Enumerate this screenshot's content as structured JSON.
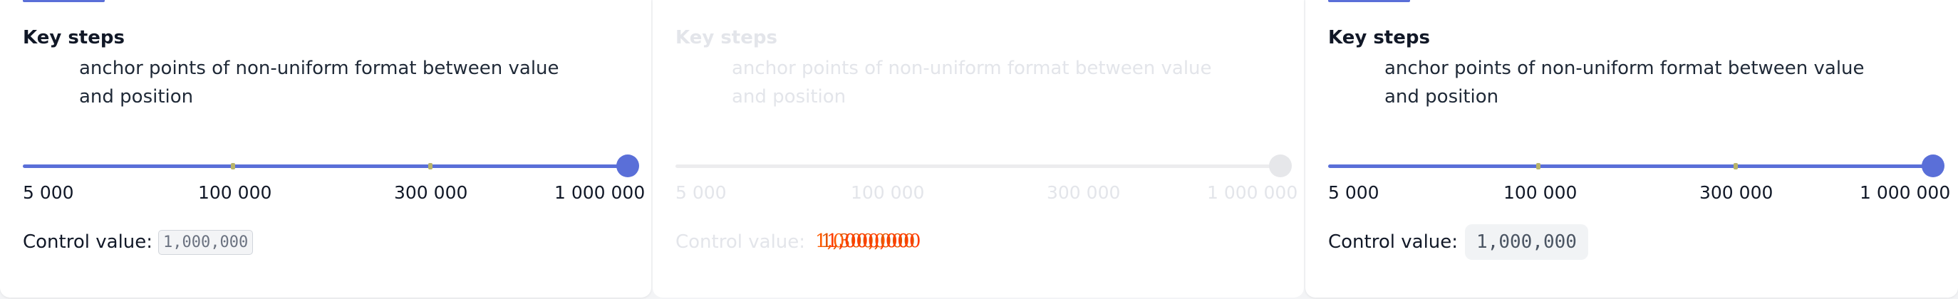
{
  "cards": [
    {
      "heading": "Key steps",
      "description": "anchor points of non-uniform format between value and position",
      "steps": [
        "5 000",
        "100 000",
        "300 000",
        "1 000 000"
      ],
      "control_label": "Control value:",
      "control_value": "1,000,000",
      "slider_value": 1000000
    },
    {
      "heading": "Key steps",
      "description": "anchor points of non-uniform format between value and position",
      "steps": [
        "5 000",
        "100 000",
        "300 000",
        "1 000 000"
      ],
      "control_label": "Control value:",
      "control_value_overlap": [
        "1,000,000",
        "1,300,000",
        "1,000,000"
      ],
      "slider_value": 1000000
    },
    {
      "heading": "Key steps",
      "description": "anchor points of non-uniform format between value and position",
      "steps": [
        "5 000",
        "100 000",
        "300 000",
        "1 000 000"
      ],
      "control_label": "Control value:",
      "control_value": "1,000,000",
      "slider_value": 1000000
    }
  ],
  "colors": {
    "accent": "#5a6fd8",
    "tick": "#b8b46a",
    "faded": "#e3e5ea",
    "ghost_text": "#ff5a00"
  }
}
